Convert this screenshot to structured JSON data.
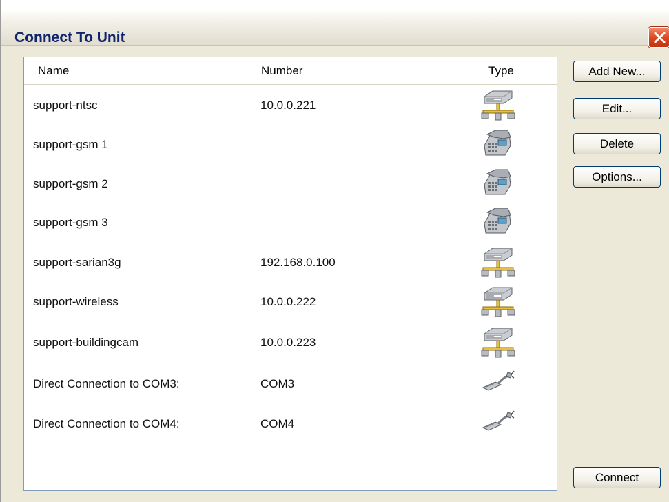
{
  "window": {
    "title": "Connect To Unit"
  },
  "columns": {
    "name": "Name",
    "number": "Number",
    "type": "Type"
  },
  "rows": [
    {
      "name": "support-ntsc",
      "number": "10.0.0.221",
      "type_icon": "network-icon"
    },
    {
      "name": "support-gsm 1",
      "number": "",
      "type_icon": "phone-icon"
    },
    {
      "name": "support-gsm 2",
      "number": "",
      "type_icon": "phone-icon"
    },
    {
      "name": "support-gsm 3",
      "number": "",
      "type_icon": "phone-icon"
    },
    {
      "name": "support-sarian3g",
      "number": "192.168.0.100",
      "type_icon": "network-icon"
    },
    {
      "name": "support-wireless",
      "number": "10.0.0.222",
      "type_icon": "network-icon"
    },
    {
      "name": "support-buildingcam",
      "number": "10.0.0.223",
      "type_icon": "network-icon"
    },
    {
      "name": "Direct Connection to COM3:",
      "number": "COM3",
      "type_icon": "serial-cable-icon"
    },
    {
      "name": "Direct Connection to COM4:",
      "number": "COM4",
      "type_icon": "serial-cable-icon"
    }
  ],
  "buttons": {
    "add_new": "Add New...",
    "edit": "Edit...",
    "delete": "Delete",
    "options": "Options...",
    "connect": "Connect"
  }
}
